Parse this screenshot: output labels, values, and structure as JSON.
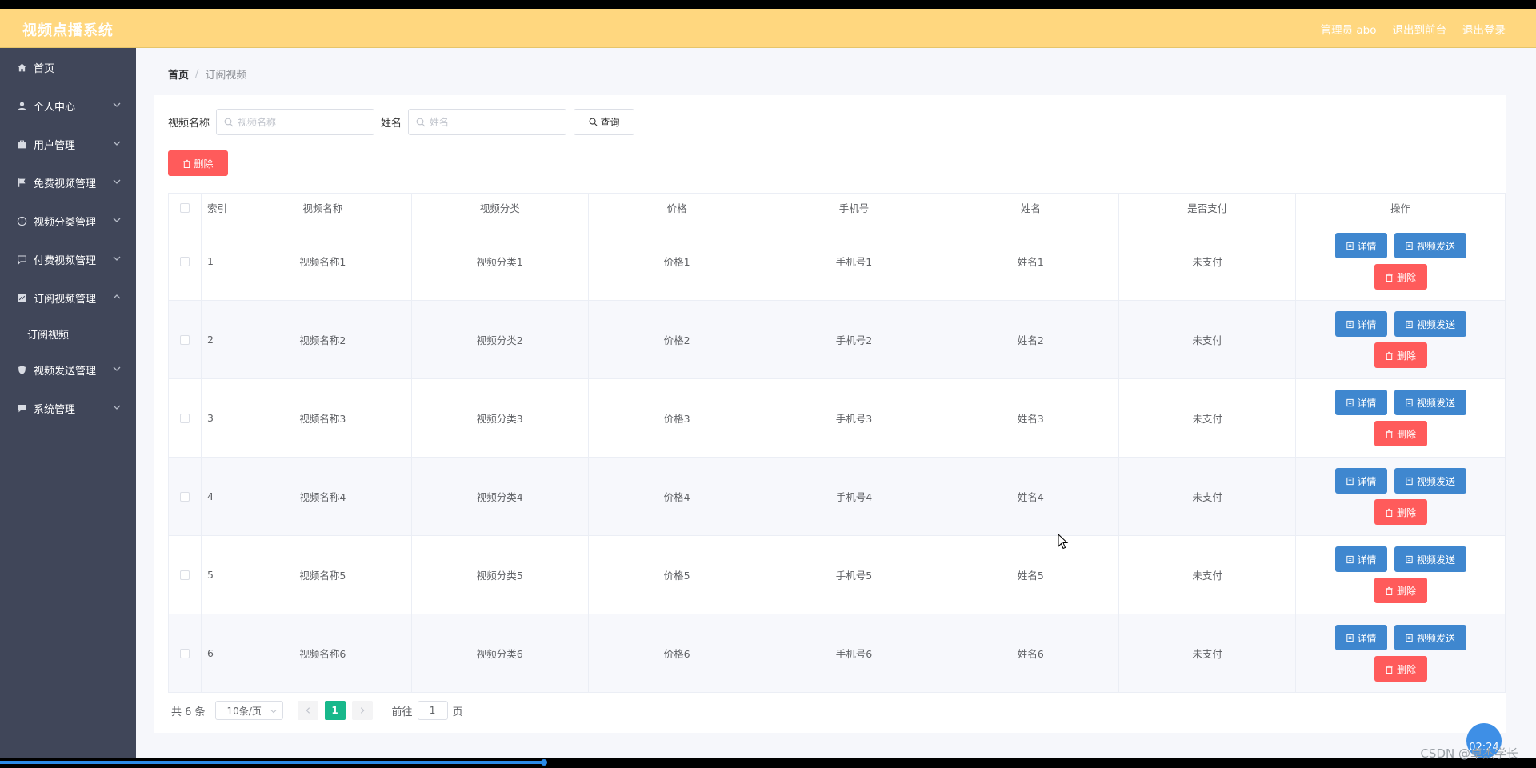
{
  "header": {
    "brand": "视频点播系统",
    "admin": "管理员 abo",
    "back_front": "退出到前台",
    "logout": "退出登录"
  },
  "sidebar": {
    "items": [
      {
        "label": "首页",
        "icon": "home-icon"
      },
      {
        "label": "个人中心",
        "icon": "user-icon"
      },
      {
        "label": "用户管理",
        "icon": "suitcase-icon"
      },
      {
        "label": "免费视频管理",
        "icon": "flag-icon"
      },
      {
        "label": "视频分类管理",
        "icon": "info-icon"
      },
      {
        "label": "付费视频管理",
        "icon": "chat-icon"
      },
      {
        "label": "订阅视频管理",
        "icon": "chart-icon"
      },
      {
        "label": "订阅视频",
        "icon": ""
      },
      {
        "label": "视频发送管理",
        "icon": "shield-icon"
      },
      {
        "label": "系统管理",
        "icon": "message-icon"
      }
    ]
  },
  "breadcrumb": {
    "home": "首页",
    "sep": "/",
    "current": "订阅视频"
  },
  "search": {
    "name_label": "视频名称",
    "name_placeholder": "视频名称",
    "xm_label": "姓名",
    "xm_placeholder": "姓名",
    "query_label": "查询"
  },
  "bulk_delete_label": "删除",
  "table": {
    "headers": [
      "索引",
      "视频名称",
      "视频分类",
      "价格",
      "手机号",
      "姓名",
      "是否支付",
      "操作"
    ],
    "rows": [
      {
        "idx": "1",
        "name": "视频名称1",
        "cat": "视频分类1",
        "price": "价格1",
        "phone": "手机号1",
        "xm": "姓名1",
        "pay": "未支付"
      },
      {
        "idx": "2",
        "name": "视频名称2",
        "cat": "视频分类2",
        "price": "价格2",
        "phone": "手机号2",
        "xm": "姓名2",
        "pay": "未支付"
      },
      {
        "idx": "3",
        "name": "视频名称3",
        "cat": "视频分类3",
        "price": "价格3",
        "phone": "手机号3",
        "xm": "姓名3",
        "pay": "未支付"
      },
      {
        "idx": "4",
        "name": "视频名称4",
        "cat": "视频分类4",
        "price": "价格4",
        "phone": "手机号4",
        "xm": "姓名4",
        "pay": "未支付"
      },
      {
        "idx": "5",
        "name": "视频名称5",
        "cat": "视频分类5",
        "price": "价格5",
        "phone": "手机号5",
        "xm": "姓名5",
        "pay": "未支付"
      },
      {
        "idx": "6",
        "name": "视频名称6",
        "cat": "视频分类6",
        "price": "价格6",
        "phone": "手机号6",
        "xm": "姓名6",
        "pay": "未支付"
      }
    ],
    "ops": {
      "detail": "详情",
      "send": "视频发送",
      "delete": "删除"
    }
  },
  "pager": {
    "total": "共 6 条",
    "size": "10条/页",
    "current": "1",
    "goto": "前往",
    "jump_value": "1",
    "unit": "页"
  },
  "overlay": {
    "timer": "02:24",
    "watermark": "CSDN @卓杰学长"
  }
}
